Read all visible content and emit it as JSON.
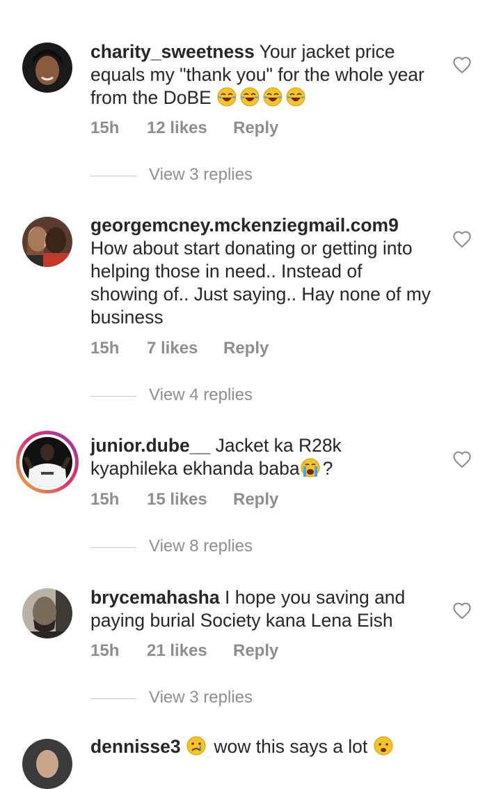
{
  "comments": [
    {
      "username": "charity_sweetness",
      "text": " Your jacket price equals my \"thank you\" for the whole year from the DoBE ",
      "emojis": [
        "laughing-tears",
        "laughing-tears",
        "laughing-tears",
        "laughing-tears"
      ],
      "time": "15h",
      "likes": "12 likes",
      "reply": "Reply",
      "view_replies": "View 3 replies"
    },
    {
      "username": "georgemcney.mckenziegmail.com9",
      "text": "How about start donating or getting into helping those in need.. Instead of showing of.. Just saying.. Hay none of my business",
      "time": "15h",
      "likes": "7 likes",
      "reply": "Reply",
      "view_replies": "View 4 replies"
    },
    {
      "username": "junior.dube__",
      "text_before": " Jacket ka R28k kyaphileka ekhanda baba",
      "text_after": "?",
      "time": "15h",
      "likes": "15 likes",
      "reply": "Reply",
      "view_replies": "View 8 replies"
    },
    {
      "username": "brycemahasha",
      "text": " I hope you saving and paying burial Society kana Lena Eish",
      "time": "15h",
      "likes": "21 likes",
      "reply": "Reply",
      "view_replies": "View 3 replies"
    },
    {
      "username": "dennisse3",
      "text_mid": " wow this says a lot "
    }
  ],
  "colors": {
    "text": "#262626",
    "secondary": "#8e8e8e",
    "story_ring": "#e1306c"
  },
  "icons": {
    "like": "heart-outline-icon"
  }
}
